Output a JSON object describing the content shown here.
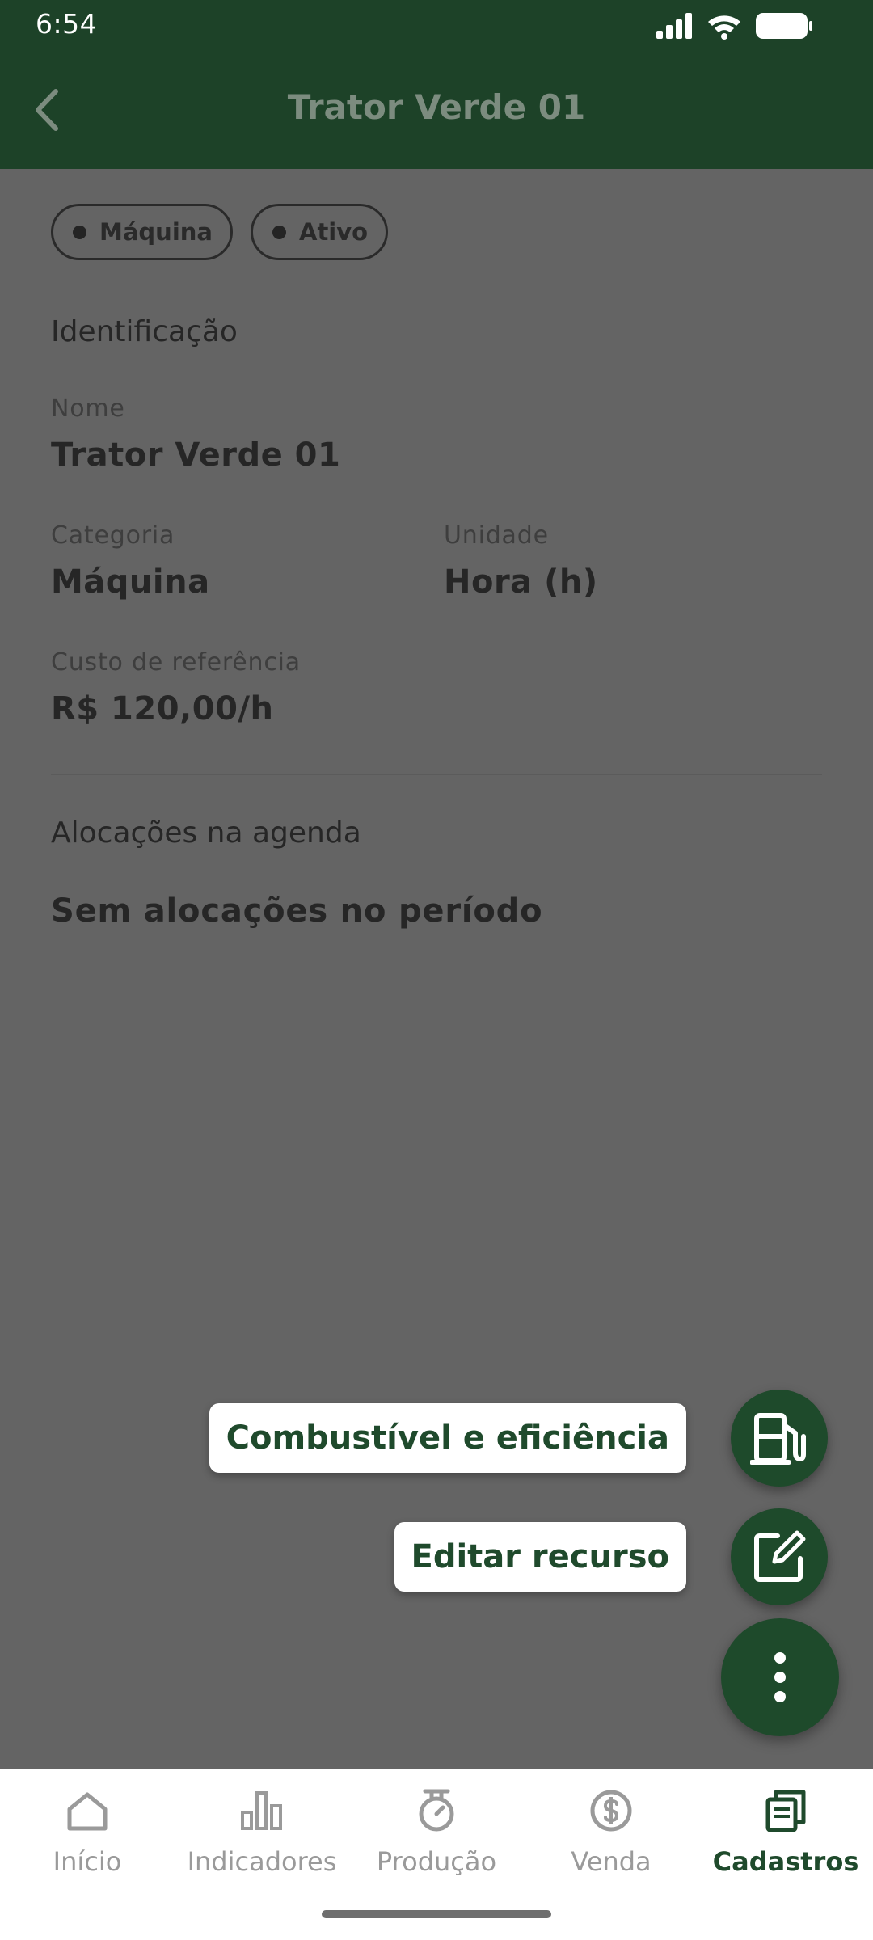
{
  "status_bar": {
    "time": "6:54"
  },
  "top_bar": {
    "title": "Trator Verde 01"
  },
  "chips": [
    {
      "label": "Máquina"
    },
    {
      "label": "Ativo"
    }
  ],
  "identification": {
    "section_title": "Identificação",
    "name_label": "Nome",
    "name_value": "Trator Verde 01",
    "category_label": "Categoria",
    "category_value": "Máquina",
    "unit_label": "Unidade",
    "unit_value": "Hora (h)",
    "cost_label": "Custo de referência",
    "cost_value": "R$ 120,00/h"
  },
  "allocations": {
    "section_title": "Alocações na agenda",
    "empty_text": "Sem alocações no período"
  },
  "fab_menu": {
    "fuel_label": "Combustível e eficiência",
    "edit_label": "Editar recurso",
    "fuel_icon": "fuel-pump-icon",
    "edit_icon": "edit-icon",
    "main_icon": "more-vertical-icon"
  },
  "bottom_nav": {
    "items": [
      {
        "label": "Início",
        "icon": "home-icon"
      },
      {
        "label": "Indicadores",
        "icon": "bar-chart-icon"
      },
      {
        "label": "Produção",
        "icon": "scale-icon"
      },
      {
        "label": "Venda",
        "icon": "dollar-icon"
      },
      {
        "label": "Cadastros",
        "icon": "registry-icon"
      }
    ],
    "active_index": 4
  },
  "colors": {
    "primary": "#1e4a2b",
    "overlay": "#646464",
    "nav_inactive": "#9a9a9a"
  }
}
